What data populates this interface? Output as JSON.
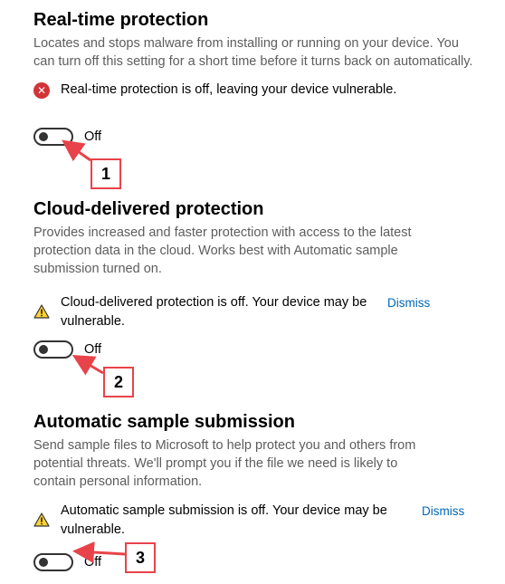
{
  "realtime": {
    "heading": "Real-time protection",
    "description": "Locates and stops malware from installing or running on your device. You can turn off this setting for a short time before it turns back on automatically.",
    "status": "Real-time protection is off, leaving your device vulnerable.",
    "toggle_label": "Off",
    "toggle_on": false,
    "callout": "1"
  },
  "cloud": {
    "heading": "Cloud-delivered protection",
    "description": "Provides increased and faster protection with access to the latest protection data in the cloud. Works best with Automatic sample submission turned on.",
    "status": "Cloud-delivered protection is off. Your device may be vulnerable.",
    "dismiss": "Dismiss",
    "toggle_label": "Off",
    "toggle_on": false,
    "callout": "2"
  },
  "sample": {
    "heading": "Automatic sample submission",
    "description": "Send sample files to Microsoft to help protect you and others from potential threats. We'll prompt you if the file we need is likely to contain personal information.",
    "status": "Automatic sample submission is off. Your device may be vulnerable.",
    "dismiss": "Dismiss",
    "toggle_label": "Off",
    "toggle_on": false,
    "callout": "3"
  },
  "colors": {
    "error": "#d13438",
    "warning": "#ffd335",
    "link": "#0067b8",
    "annotation": "#e8434a"
  },
  "icons": {
    "error": "error-circle-x-icon",
    "warning": "warning-triangle-icon"
  }
}
